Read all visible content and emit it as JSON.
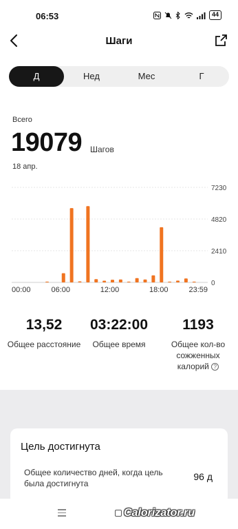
{
  "status_bar": {
    "time": "06:53",
    "battery": "44",
    "icons": [
      "nfc-icon",
      "mute-icon",
      "bluetooth-icon",
      "wifi-icon",
      "signal-icon",
      "battery-icon"
    ]
  },
  "header": {
    "title": "Шаги",
    "back_icon": "chevron-left-icon",
    "share_icon": "share-icon"
  },
  "tabs": [
    {
      "label": "Д",
      "active": true
    },
    {
      "label": "Нед",
      "active": false
    },
    {
      "label": "Мес",
      "active": false
    },
    {
      "label": "Г",
      "active": false
    }
  ],
  "summary": {
    "label": "Всего",
    "value": "19079",
    "unit": "Шагов",
    "date": "18 апр."
  },
  "chart_data": {
    "type": "bar",
    "color": "#f07421",
    "x_tick_labels": [
      "00:00",
      "06:00",
      "12:00",
      "18:00",
      "23:59"
    ],
    "y_tick_labels": [
      "7230",
      "4820",
      "2410",
      "0"
    ],
    "ylim": [
      0,
      7230
    ],
    "grid": true,
    "bars": [
      {
        "hour": 4.0,
        "value": 60
      },
      {
        "hour": 6.0,
        "value": 700
      },
      {
        "hour": 7.0,
        "value": 5650
      },
      {
        "hour": 8.0,
        "value": 80
      },
      {
        "hour": 9.0,
        "value": 5800
      },
      {
        "hour": 10.0,
        "value": 250
      },
      {
        "hour": 11.0,
        "value": 130
      },
      {
        "hour": 12.0,
        "value": 200
      },
      {
        "hour": 13.0,
        "value": 220
      },
      {
        "hour": 14.0,
        "value": 60
      },
      {
        "hour": 15.0,
        "value": 330
      },
      {
        "hour": 16.0,
        "value": 220
      },
      {
        "hour": 17.0,
        "value": 540
      },
      {
        "hour": 18.0,
        "value": 4200
      },
      {
        "hour": 19.0,
        "value": 60
      },
      {
        "hour": 20.0,
        "value": 140
      },
      {
        "hour": 21.0,
        "value": 300
      },
      {
        "hour": 22.0,
        "value": 60
      }
    ]
  },
  "stats": [
    {
      "value": "13,52",
      "label": "Общее расстояние"
    },
    {
      "value": "03:22:00",
      "label": "Общее время"
    },
    {
      "value": "1193",
      "label": "Общее кол-во сожженных калорий"
    }
  ],
  "goal": {
    "title": "Цель достигнута",
    "desc": "Общее количество дней, когда цель была достигнута",
    "value": "96 д"
  },
  "watermark": "Calorizator.ru"
}
